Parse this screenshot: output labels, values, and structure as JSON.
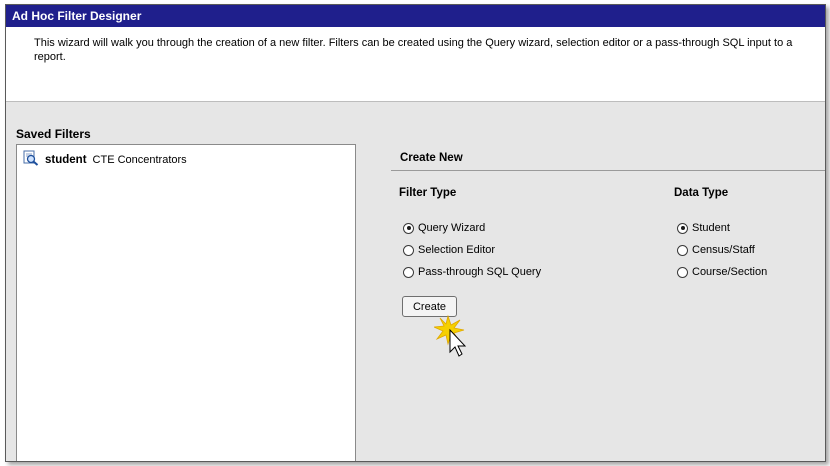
{
  "window": {
    "title": "Ad Hoc Filter Designer"
  },
  "intro": {
    "text": "This wizard will walk you through the creation of a new filter. Filters can be created using the Query wizard, selection editor or a pass-through SQL input to a report."
  },
  "saved_filters": {
    "label": "Saved Filters",
    "items": [
      {
        "name": "student",
        "description": "CTE Concentrators",
        "icon": "magnifier-icon"
      }
    ]
  },
  "create_new": {
    "header": "Create New",
    "filter_type": {
      "title": "Filter Type",
      "options": [
        "Query Wizard",
        "Selection Editor",
        "Pass-through SQL Query"
      ],
      "selected": "Query Wizard"
    },
    "data_type": {
      "title": "Data Type",
      "options": [
        "Student",
        "Census/Staff",
        "Course/Section"
      ],
      "selected": "Student"
    },
    "create_label": "Create"
  },
  "colors": {
    "titlebar": "#1f1f8c",
    "panel": "#e6e6e6",
    "highlight": "#f5d000"
  }
}
